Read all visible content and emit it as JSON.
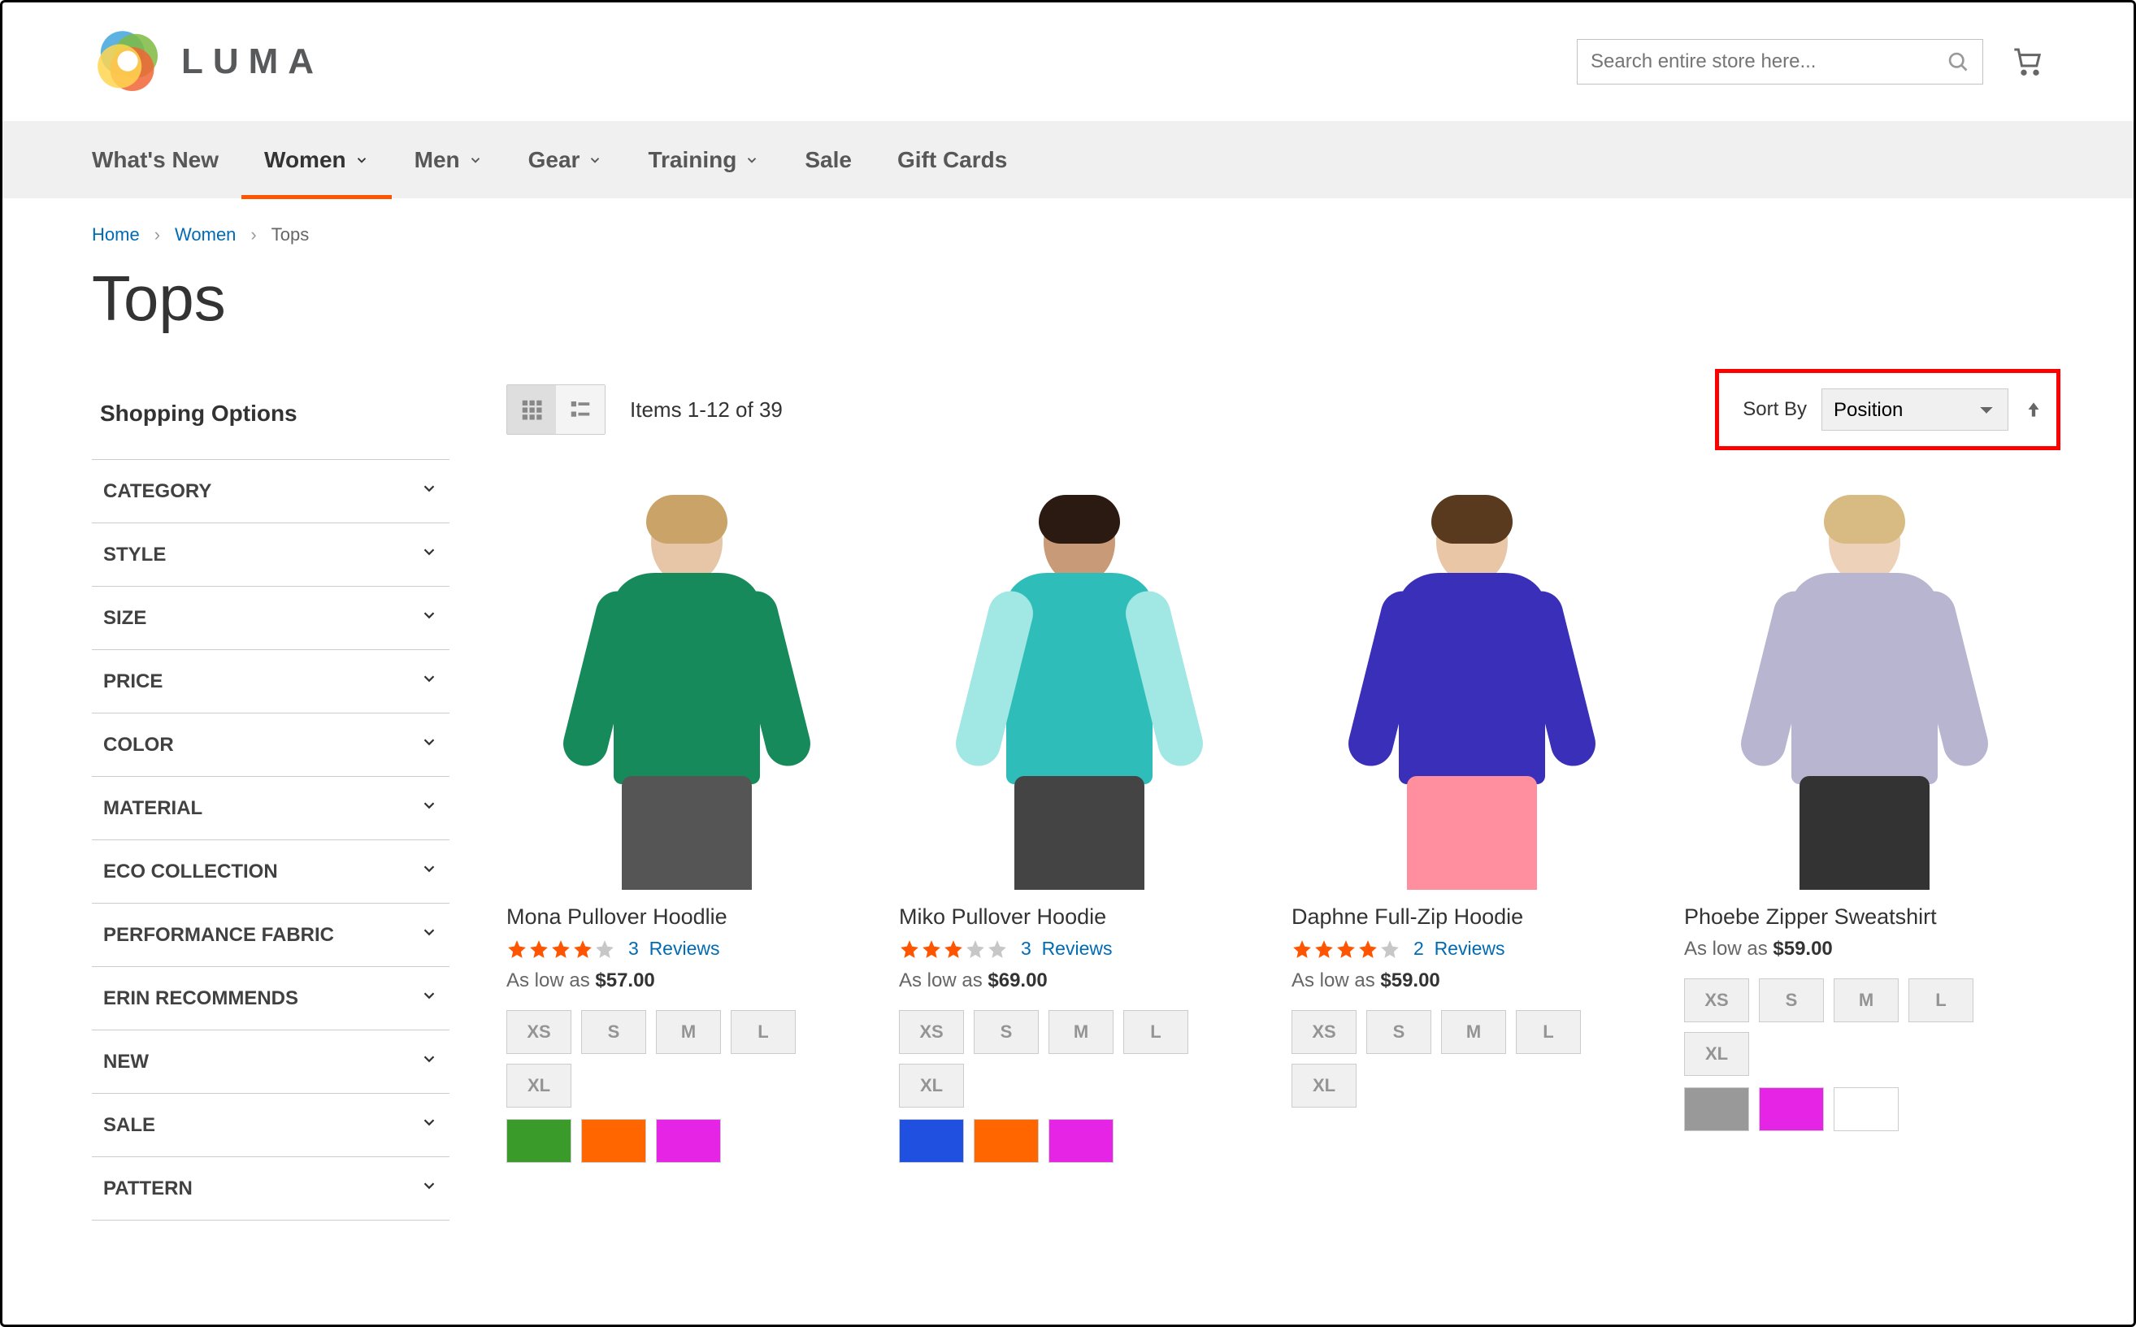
{
  "header": {
    "logo_text": "LUMA",
    "search_placeholder": "Search entire store here..."
  },
  "nav": {
    "items": [
      {
        "label": "What's New",
        "has_menu": false
      },
      {
        "label": "Women",
        "has_menu": true,
        "active": true
      },
      {
        "label": "Men",
        "has_menu": true
      },
      {
        "label": "Gear",
        "has_menu": true
      },
      {
        "label": "Training",
        "has_menu": true
      },
      {
        "label": "Sale",
        "has_menu": false
      },
      {
        "label": "Gift Cards",
        "has_menu": false
      }
    ]
  },
  "breadcrumbs": {
    "home": "Home",
    "women": "Women",
    "current": "Tops"
  },
  "page_title": "Tops",
  "sidebar": {
    "title": "Shopping Options",
    "filters": [
      "CATEGORY",
      "STYLE",
      "SIZE",
      "PRICE",
      "COLOR",
      "MATERIAL",
      "ECO COLLECTION",
      "PERFORMANCE FABRIC",
      "ERIN RECOMMENDS",
      "NEW",
      "SALE",
      "PATTERN"
    ]
  },
  "toolbar": {
    "count_text": "Items 1-12 of 39",
    "sort_label": "Sort By",
    "sort_value": "Position"
  },
  "products": [
    {
      "name": "Mona Pullover Hoodlie",
      "rating": 4,
      "reviews_count": "3",
      "reviews_word": "Reviews",
      "price_prefix": "As low as",
      "price": "$57.00",
      "sizes": [
        "XS",
        "S",
        "M",
        "L",
        "XL"
      ],
      "colors": [
        "#3a9b2b",
        "#ff6600",
        "#e524e5"
      ],
      "fig": {
        "skin": "#e7c6a8",
        "hair": "#caa368",
        "top": "#178a5b",
        "sleeve": "#178a5b",
        "bottom": "#555"
      }
    },
    {
      "name": "Miko Pullover Hoodie",
      "rating": 3,
      "reviews_count": "3",
      "reviews_word": "Reviews",
      "price_prefix": "As low as",
      "price": "$69.00",
      "sizes": [
        "XS",
        "S",
        "M",
        "L",
        "XL"
      ],
      "colors": [
        "#2050e0",
        "#ff6600",
        "#e524e5"
      ],
      "fig": {
        "skin": "#c99a78",
        "hair": "#2b1a12",
        "top": "#2fbdb9",
        "sleeve": "#a1e7e4",
        "bottom": "#444"
      }
    },
    {
      "name": "Daphne Full-Zip Hoodie",
      "rating": 4,
      "reviews_count": "2",
      "reviews_word": "Reviews",
      "price_prefix": "As low as",
      "price": "$59.00",
      "sizes": [
        "XS",
        "S",
        "M",
        "L",
        "XL"
      ],
      "colors": [],
      "fig": {
        "skin": "#e8c6a6",
        "hair": "#5a3a1e",
        "top": "#3a2fb8",
        "sleeve": "#3a2fb8",
        "bottom": "#ff8e9e"
      }
    },
    {
      "name": "Phoebe Zipper Sweatshirt",
      "rating": 0,
      "reviews_count": "",
      "reviews_word": "",
      "price_prefix": "As low as",
      "price": "$59.00",
      "sizes": [
        "XS",
        "S",
        "M",
        "L",
        "XL"
      ],
      "colors": [
        "#999999",
        "#e524e5",
        "#ffffff"
      ],
      "fig": {
        "skin": "#edd1b8",
        "hair": "#d8bb82",
        "top": "#b7b5cf",
        "sleeve": "#b7b5cf",
        "bottom": "#333"
      }
    }
  ]
}
